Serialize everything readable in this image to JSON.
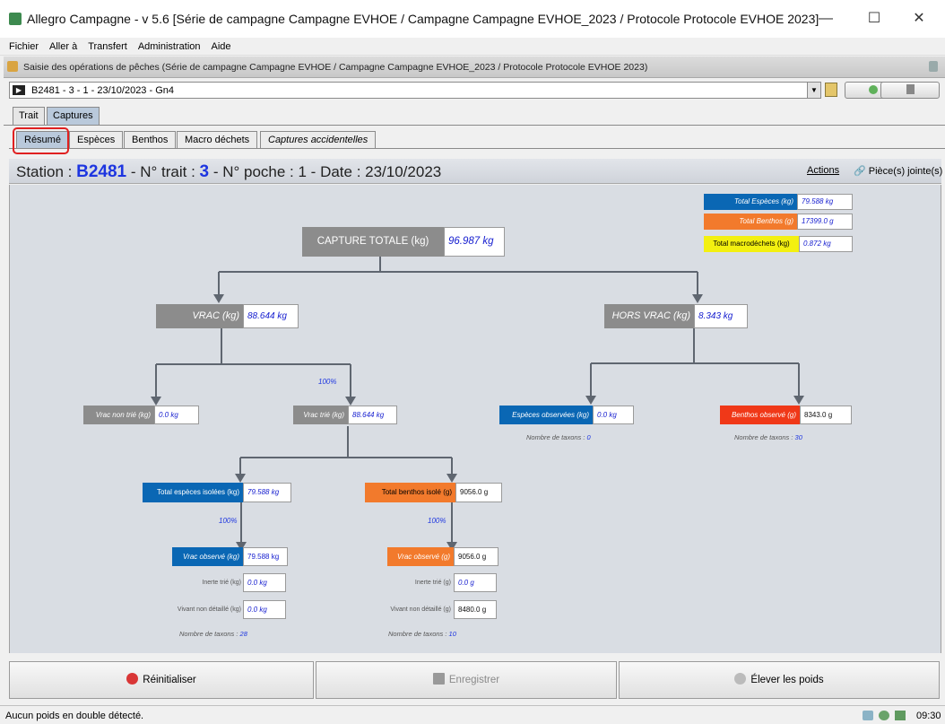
{
  "window": {
    "title": "Allegro Campagne - v 5.6 [Série de campagne Campagne EVHOE / Campagne Campagne EVHOE_2023 / Protocole Protocole EVHOE 2023]",
    "minimize": "—",
    "maximize": "☐",
    "close": "✕"
  },
  "menu": [
    "Fichier",
    "Aller à",
    "Transfert",
    "Administration",
    "Aide"
  ],
  "frame": {
    "title": "Saisie des opérations de pêches (Série de campagne Campagne EVHOE / Campagne Campagne EVHOE_2023 / Protocole Protocole EVHOE 2023)"
  },
  "selector": {
    "value": "B2481 - 3 - 1 - 23/10/2023 - Gn4"
  },
  "tabs": {
    "outer": [
      "Trait",
      "Captures"
    ],
    "inner": [
      "Résumé",
      "Espèces",
      "Benthos",
      "Macro déchets",
      "Captures accidentelles"
    ]
  },
  "station": {
    "label_station": "Station : ",
    "station": "B2481",
    "label_trait": " - N° trait : ",
    "trait": "3",
    "rest": " - N° poche : 1 - Date : 23/10/2023",
    "actions": "Actions",
    "attachments": "Pièce(s) jointe(s)"
  },
  "summary": {
    "total_especes_label": "Total Espèces (kg)",
    "total_especes": "79.588 kg",
    "total_benthos_label": "Total Benthos (g)",
    "total_benthos": "17399.0 g",
    "total_macro_label": "Total macrodéchets (kg)",
    "total_macro": "0.872 kg"
  },
  "tree": {
    "capture_label": "CAPTURE TOTALE (kg)",
    "capture": "96.987 kg",
    "vrac_label": "VRAC (kg)",
    "vrac": "88.644 kg",
    "hors_vrac_label": "HORS VRAC (kg)",
    "hors_vrac": "8.343 kg",
    "vrac_non_trie_label": "Vrac non trié (kg)",
    "vrac_non_trie": "0.0 kg",
    "pct_vrac_trie": "100%",
    "vrac_trie_label": "Vrac trié (kg)",
    "vrac_trie": "88.644 kg",
    "especes_obs_label": "Espèces observées (kg)",
    "especes_obs": "0.0 kg",
    "nb_taxons_label": "Nombre de taxons : ",
    "especes_obs_taxons": "0",
    "benthos_obs_label": "Benthos observé (g)",
    "benthos_obs": "8343.0 g",
    "benthos_obs_taxons": "30",
    "total_esp_isolees_label": "Total espèces isolées (kg)",
    "total_esp_isolees": "79.588 kg",
    "pct_esp": "100%",
    "vrac_obs_kg_label": "Vrac observé (kg)",
    "vrac_obs_kg": "79.588 kg",
    "inerte_kg_label": "Inerte trié (kg)",
    "inerte_kg": "0.0 kg",
    "vivant_kg_label": "Vivant non détaillé (kg)",
    "vivant_kg": "0.0 kg",
    "esp_taxons": "28",
    "total_benthos_isole_label": "Total benthos isolé (g)",
    "total_benthos_isole": "9056.0 g",
    "pct_benthos": "100%",
    "vrac_obs_g_label": "Vrac observé (g)",
    "vrac_obs_g": "9056.0 g",
    "inerte_g_label": "Inerte trié (g)",
    "inerte_g": "0.0 g",
    "vivant_g_label": "Vivant non détaillé (g)",
    "vivant_g": "8480.0 g",
    "benthos_taxons": "10"
  },
  "buttons": {
    "reset": "Réinitialiser",
    "save": "Enregistrer",
    "raise": "Élever les poids"
  },
  "status": {
    "message": "Aucun poids en double détecté.",
    "time": "09:30"
  },
  "colors": {
    "blue": "#0a67b4",
    "orange": "#f27a2c",
    "red": "#f03818",
    "yellow": "#f3f010",
    "gray": "#8c8c8c"
  }
}
